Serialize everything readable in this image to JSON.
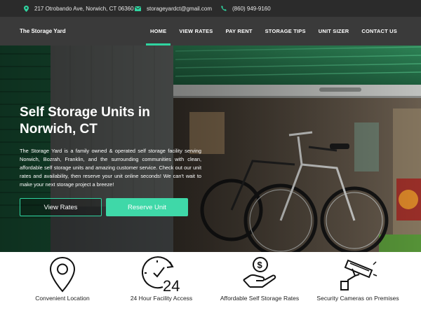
{
  "topbar": {
    "address": "217 Otrobando Ave, Norwich, CT 06360",
    "email": "storageyardct@gmail.com",
    "phone": "(860) 949-9160"
  },
  "brand": {
    "name": "The Storage Yard"
  },
  "nav": {
    "items": [
      {
        "label": "HOME",
        "active": true
      },
      {
        "label": "VIEW RATES"
      },
      {
        "label": "PAY RENT"
      },
      {
        "label": "STORAGE TIPS"
      },
      {
        "label": "UNIT SIZER"
      },
      {
        "label": "CONTACT US"
      }
    ]
  },
  "hero": {
    "title": "Self Storage Units in Norwich, CT",
    "text": "The Storage Yard is a family owned & operated self storage facility serving Norwich, Bozrah, Franklin, and the surrounding communities with clean, affordable self storage units and amazing customer service. Check out our unit rates and availability, then reserve your unit online seconds! We can't wait to make your next storage project a breeze!",
    "view_rates_label": "View Rates",
    "reserve_label": "Reserve Unit"
  },
  "features": [
    {
      "label": "Convenient Location",
      "icon": "location-pin-icon"
    },
    {
      "label": "24 Hour Facility Access",
      "icon": "clock-24-icon"
    },
    {
      "label": "Affordable Self Storage Rates",
      "icon": "dollar-hand-icon"
    },
    {
      "label": "Security Cameras on Premises",
      "icon": "security-camera-icon"
    }
  ],
  "colors": {
    "accent": "#2fd4a0",
    "topbar": "#2b2b2b",
    "navbar": "#3a3a3a"
  }
}
